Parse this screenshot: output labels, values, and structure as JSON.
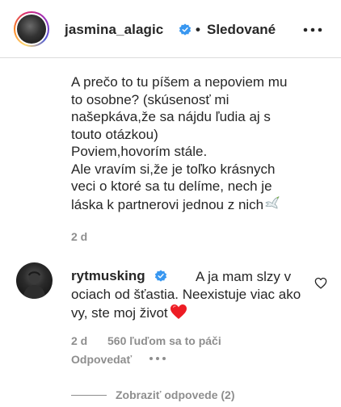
{
  "header": {
    "username": "jasmina_alagic",
    "separator": "•",
    "follow_status": "Sledované",
    "verified_color": "#3897f0",
    "avatar_icon": "profile-photo",
    "more_icon": "more-horizontal-icon"
  },
  "comment": {
    "text": "A prečo to tu píšem a nepoviem mu\nto osobne? (skúsenosť mi\nnašepkáva,že sa nájdu ľudia aj s\ntouto otázkou)\nPoviem,hovorím stále.\nAle vravím si,že je toľko krásnych\nveci o ktoré sa tu delíme, nech je\nláska k partnerovi jednou z nich",
    "emoji_icon": "dove-emoji",
    "time": "2 d"
  },
  "reply": {
    "username": "rytmusking",
    "text": "A ja mam slzy v ociach od šťastia. Neexistuje viac ako vy, ste moj život",
    "emoji_icon": "red-heart-emoji",
    "heart_color": "#ed1c24",
    "time": "2 d",
    "likes": "560 ľuďom sa to páči",
    "reply_label": "Odpovedať",
    "like_icon": "heart-outline-icon",
    "more_icon": "more-horizontal-icon"
  },
  "view_replies": {
    "label": "Zobraziť odpovede (2)"
  }
}
